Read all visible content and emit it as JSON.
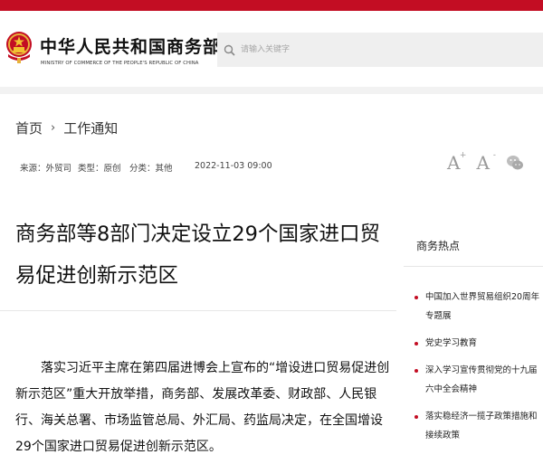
{
  "site": {
    "name_cn": "中华人民共和国商务部",
    "name_en": "MINISTRY OF COMMERCE OF THE PEOPLE'S REPUBLIC OF CHINA",
    "brand_color": "#c30d23"
  },
  "search": {
    "placeholder": "请输入关键字",
    "icon": "search-icon"
  },
  "breadcrumb": {
    "home": "首页",
    "separator": "›",
    "current": "工作通知"
  },
  "meta": {
    "source": "来源：外贸司",
    "type": "类型：原创",
    "category": "分类：其他",
    "datetime": "2022-11-03 09:00"
  },
  "tools": {
    "font_increase": "A",
    "font_increase_mark": "+",
    "font_decrease": "A",
    "font_decrease_mark": "-",
    "share_icon": "wechat-icon"
  },
  "article": {
    "title": "商务部等8部门决定设立29个国家进口贸易促进创新示范区",
    "body": "落实习近平主席在第四届进博会上宣布的“增设进口贸易促进创新示范区”重大开放举措，商务部、发展改革委、财政部、人民银行、海关总署、市场监管总局、外汇局、药监局决定，在全国增设29个国家进口贸易促进创新示范区。"
  },
  "sidebar": {
    "title": "商务热点",
    "items": [
      "中国加入世界贸易组织20周年专题展",
      "党史学习教育",
      "深入学习宣传贯彻党的十九届六中全会精神",
      "落实稳经济一揽子政策措施和接续政策"
    ]
  }
}
